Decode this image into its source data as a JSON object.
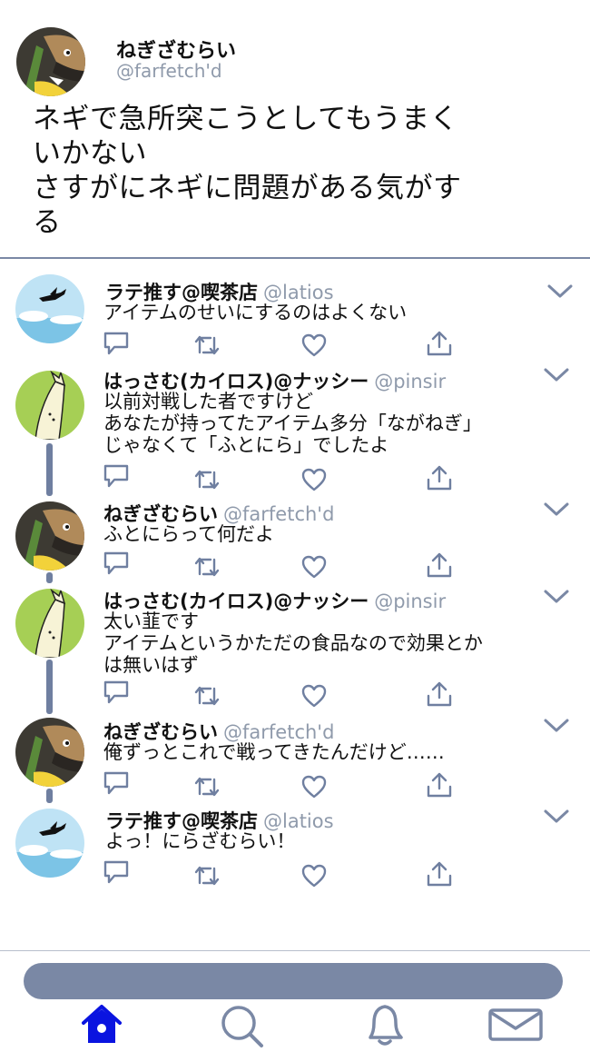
{
  "main_tweet": {
    "name": "ねぎざむらい",
    "handle": "@farfetch'd",
    "lines": [
      "ネギで急所突こうとしてもうまく",
      "いかない",
      "さすがにネギに問題がある気がす",
      "る"
    ]
  },
  "replies": [
    {
      "name": "ラテ推す@喫茶店",
      "handle": "@latios",
      "lines": [
        "アイテムのせいにするのはよくない"
      ],
      "avatar": "sky-plane"
    },
    {
      "name": "はっさむ(カイロス)@ナッシー",
      "handle": "@pinsir",
      "lines": [
        "以前対戦した者ですけど",
        "あなたが持ってたアイテム多分「ながねぎ」",
        "じゃなくて「ふとにら」でしたよ"
      ],
      "avatar": "green-leek"
    },
    {
      "name": "ねぎざむらい",
      "handle": "@farfetch'd",
      "lines": [
        "ふとにらって何だよ"
      ],
      "avatar": "bird"
    },
    {
      "name": "はっさむ(カイロス)@ナッシー",
      "handle": "@pinsir",
      "lines": [
        "太い韮です",
        "アイテムというかただの食品なので効果とか",
        "は無いはず"
      ],
      "avatar": "green-leek"
    },
    {
      "name": "ねぎざむらい",
      "handle": "@farfetch'd",
      "lines": [
        "俺ずっとこれで戦ってきたんだけど……"
      ],
      "avatar": "bird"
    },
    {
      "name": "ラテ推す@喫茶店",
      "handle": "@latios",
      "lines": [
        "よっ！にらざむらい！"
      ],
      "avatar": "sky-plane"
    }
  ],
  "nav": {
    "items": [
      "home-icon",
      "search-icon",
      "notifications-icon",
      "messages-icon"
    ],
    "active": "home-icon",
    "active_color": "#0a14e0",
    "inactive_color": "#7a88a5"
  },
  "colors": {
    "accent": "#7a88a5",
    "handle": "#8f9aab",
    "icon": "#6f7fa0"
  }
}
